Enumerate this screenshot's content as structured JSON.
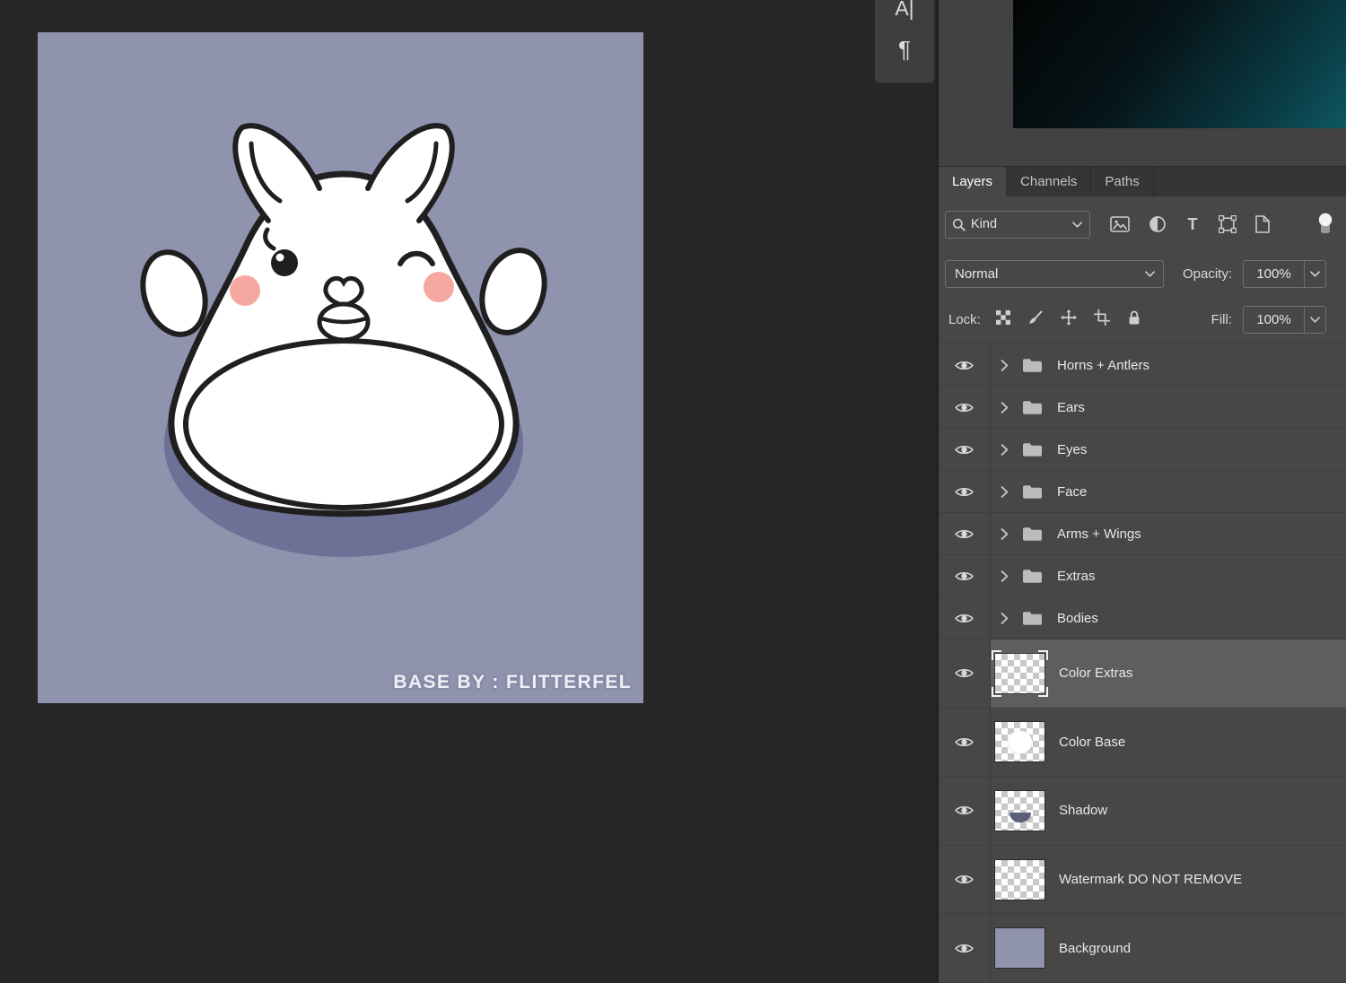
{
  "canvas": {
    "watermark": "BASE BY : FLITTERFEL",
    "background_color": "#8f93ae",
    "shadow_color": "#6d7195",
    "cheek_color": "#f5a8a0",
    "outline_color": "#1f1f1f"
  },
  "dock": {
    "character_icon": "A|",
    "paragraph_icon": "¶"
  },
  "panel": {
    "tabs": [
      {
        "label": "Layers",
        "active": true
      },
      {
        "label": "Channels",
        "active": false
      },
      {
        "label": "Paths",
        "active": false
      }
    ],
    "filter": {
      "kind_label": "Kind",
      "type_icon_glyph": "T",
      "icons": [
        "search-icon",
        "pixel-layer-filter-icon",
        "adjustment-layer-filter-icon",
        "type-layer-filter-icon",
        "shape-layer-filter-icon",
        "smart-object-filter-icon",
        "layer-filter-toggle"
      ]
    },
    "blend": {
      "mode": "Normal",
      "opacity_label": "Opacity:",
      "opacity_value": "100%"
    },
    "lock": {
      "label": "Lock:",
      "fill_label": "Fill:",
      "fill_value": "100%"
    },
    "groups": [
      {
        "label": "Horns + Antlers"
      },
      {
        "label": "Ears"
      },
      {
        "label": "Eyes"
      },
      {
        "label": "Face"
      },
      {
        "label": "Arms + Wings"
      },
      {
        "label": "Extras"
      },
      {
        "label": "Bodies"
      }
    ],
    "layers": [
      {
        "label": "Color Extras",
        "selected": true,
        "thumb": "checker"
      },
      {
        "label": "Color Base",
        "selected": false,
        "thumb": "checker-blob"
      },
      {
        "label": "Shadow",
        "selected": false,
        "thumb": "checker-shadow"
      },
      {
        "label": "Watermark DO NOT REMOVE",
        "selected": false,
        "thumb": "checker"
      },
      {
        "label": "Background",
        "selected": false,
        "thumb": "solid"
      }
    ],
    "colors": {
      "panel_bg": "#474747",
      "selected_row": "#5e5e5e",
      "preview_gradient_end": "#0e5762"
    }
  }
}
